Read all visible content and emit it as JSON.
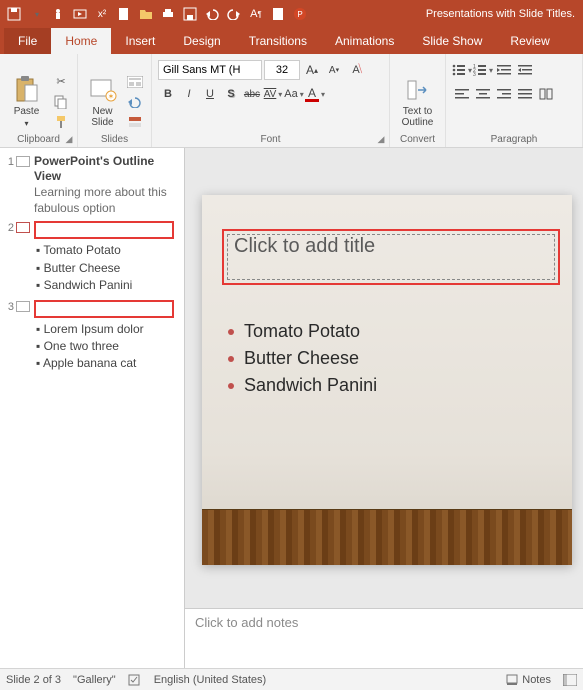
{
  "app": {
    "title": "Presentations with Slide Titles."
  },
  "tabs": {
    "file": "File",
    "home": "Home",
    "insert": "Insert",
    "design": "Design",
    "transitions": "Transitions",
    "animations": "Animations",
    "slideshow": "Slide Show",
    "review": "Review"
  },
  "ribbon": {
    "clipboard": {
      "label": "Clipboard",
      "paste": "Paste"
    },
    "slides": {
      "label": "Slides",
      "new_slide": "New\nSlide"
    },
    "font": {
      "label": "Font",
      "name": "Gill Sans MT (H",
      "size": "32",
      "bold": "B",
      "italic": "I",
      "underline": "U",
      "strike": "abc",
      "charspace": "AV",
      "casebtn": "Aa"
    },
    "paragraph": {
      "label": "Paragraph",
      "text_to_outline": "Text to\nOutline"
    },
    "convert": {
      "label": "Convert"
    }
  },
  "outline": {
    "slides": [
      {
        "num": "1",
        "title": "PowerPoint's Outline View",
        "subtitle": "Learning more about this fabulous option",
        "bullets": []
      },
      {
        "num": "2",
        "title": "",
        "bullets": [
          "Tomato Potato",
          "Butter Cheese",
          "Sandwich Panini"
        ]
      },
      {
        "num": "3",
        "title": "",
        "bullets": [
          "Lorem Ipsum dolor",
          "One two three",
          "Apple banana cat"
        ]
      }
    ]
  },
  "slide": {
    "title_placeholder": "Click to add title",
    "bullets": [
      "Tomato Potato",
      "Butter Cheese",
      "Sandwich Panini"
    ]
  },
  "notes": {
    "placeholder": "Click to add notes"
  },
  "status": {
    "slide_count": "Slide 2 of 3",
    "theme": "\"Gallery\"",
    "language": "English (United States)",
    "notes_btn": "Notes"
  }
}
